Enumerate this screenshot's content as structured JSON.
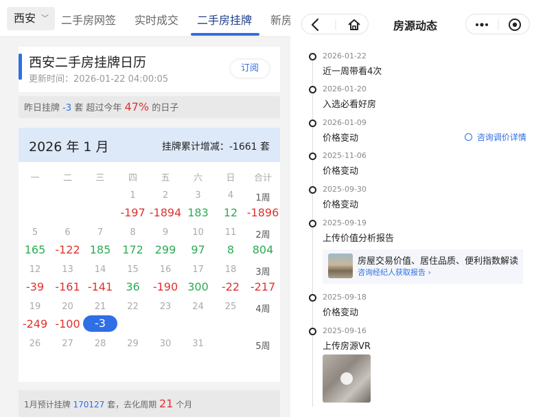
{
  "left": {
    "tabs": {
      "city": "西安",
      "items": [
        "二手房网签",
        "实时成交",
        "二手房挂牌",
        "新房"
      ],
      "active_index": 2
    },
    "calendar_card": {
      "title": "西安二手房挂牌日历",
      "updated": "更新时间：2026-01-22 04:00:05",
      "subscribe_label": "订阅"
    },
    "yesterday": {
      "prefix": "昨日挂牌",
      "value": "-3",
      "mid": "套 超过今年",
      "percent": "47%",
      "suffix": "的日子"
    },
    "calendar": {
      "month_title": "2026 年 1 月",
      "accumulated": "挂牌累计增减：-1661 套",
      "weekdays": [
        "一",
        "二",
        "三",
        "四",
        "五",
        "六",
        "日",
        "合计"
      ],
      "weeks": [
        {
          "days": [
            "",
            "",
            "",
            "1",
            "2",
            "3",
            "4"
          ],
          "label": "1周",
          "values": [
            "",
            "",
            "",
            "-197",
            "-1894",
            "183",
            "12"
          ],
          "total": "-1896"
        },
        {
          "days": [
            "5",
            "6",
            "7",
            "8",
            "9",
            "10",
            "11"
          ],
          "label": "2周",
          "values": [
            "165",
            "-122",
            "185",
            "172",
            "299",
            "97",
            "8"
          ],
          "total": "804"
        },
        {
          "days": [
            "12",
            "13",
            "14",
            "15",
            "16",
            "17",
            "18"
          ],
          "label": "3周",
          "values": [
            "-39",
            "-161",
            "-141",
            "36",
            "-190",
            "300",
            "-22"
          ],
          "total": "-217"
        },
        {
          "days": [
            "19",
            "20",
            "21",
            "22",
            "23",
            "24",
            "25"
          ],
          "label": "4周",
          "values": [
            "-249",
            "-100",
            "-3",
            "",
            "",
            "",
            ""
          ],
          "total": ""
        },
        {
          "days": [
            "26",
            "27",
            "28",
            "29",
            "30",
            "31",
            ""
          ],
          "label": "5周",
          "values": [
            "",
            "",
            "",
            "",
            "",
            "",
            ""
          ],
          "total": ""
        }
      ],
      "today": "-3"
    },
    "forecast": {
      "prefix": "1月预计挂牌",
      "value": "170127",
      "mid": "套，去化周期",
      "period": "21",
      "suffix": "个月"
    }
  },
  "right": {
    "nav_title": "房源动态",
    "timeline": [
      {
        "date": "2026-01-22",
        "text": "近一周带看4次"
      },
      {
        "date": "2026-01-20",
        "text": "入选必看好房"
      },
      {
        "date": "2026-01-09",
        "text": "价格变动",
        "action": "咨询调价详情"
      },
      {
        "date": "2025-11-06",
        "text": "价格变动"
      },
      {
        "date": "2025-09-30",
        "text": "价格变动"
      },
      {
        "date": "2025-09-19",
        "text": "上传价值分析报告"
      },
      {
        "date": "2025-09-18",
        "text": "价格变动"
      },
      {
        "date": "2025-09-16",
        "text": "上传房源VR"
      }
    ],
    "report": {
      "title": "房屋交易价值、居住品质、便利指数解读",
      "link": "咨询经纪人获取报告 ›"
    }
  },
  "colors": {
    "accent": "#2f6ee5",
    "negative": "#e0312d",
    "positive": "#2cab54",
    "header_bg": "#dde9f8"
  }
}
